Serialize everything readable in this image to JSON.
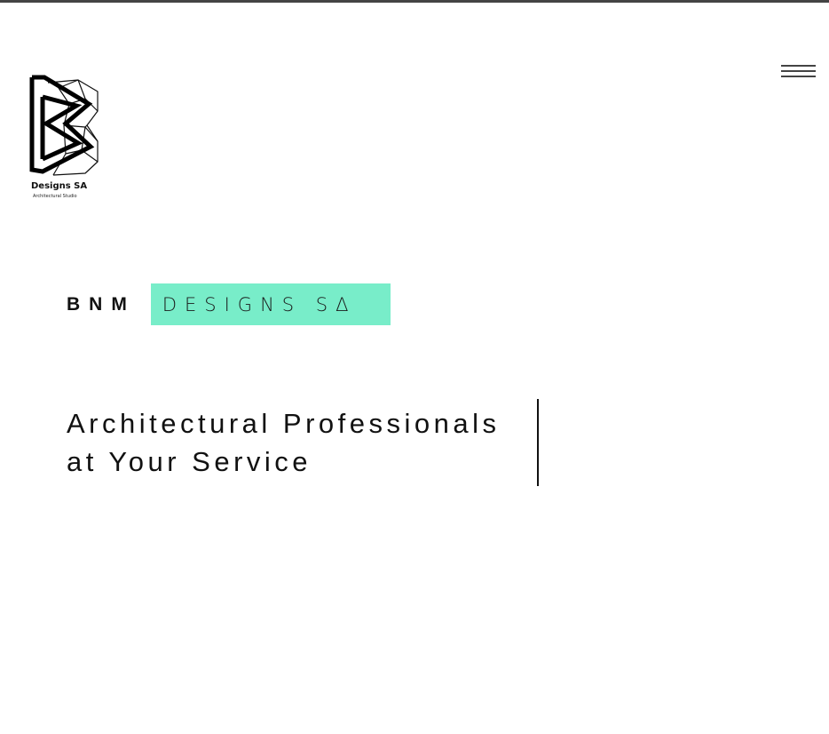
{
  "header": {
    "logo": {
      "name": "Designs SA",
      "tagline": "Architectural Studio",
      "icon": "bnm-logo-icon"
    },
    "menu": {
      "icon": "hamburger-menu-icon"
    }
  },
  "hero": {
    "brand_prefix": "BNM",
    "brand_highlight": "DESIGNS SΔ",
    "highlight_color": "#78edc9",
    "headline": {
      "line1": "Architectural Professionals",
      "line2": "at Your Service"
    }
  }
}
